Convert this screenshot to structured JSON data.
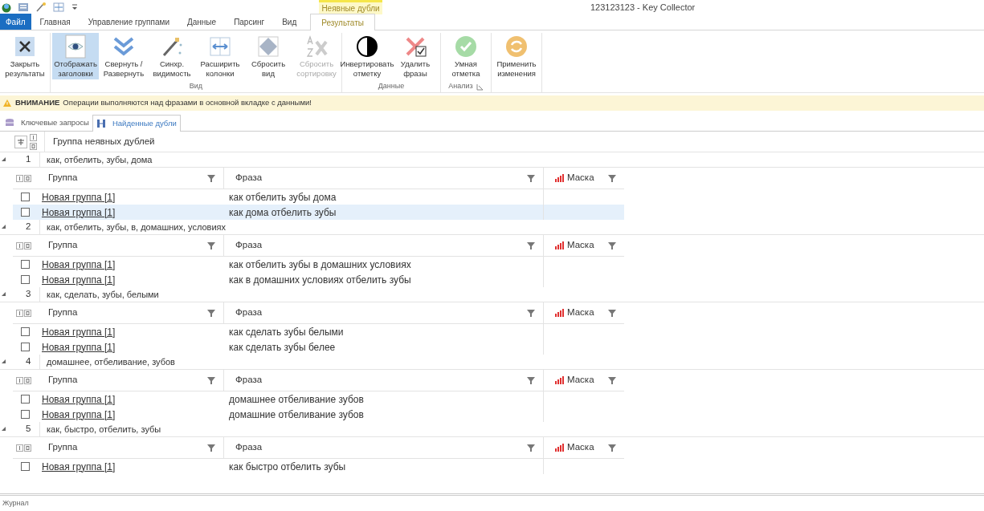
{
  "window": {
    "title": "123123123 - Key Collector"
  },
  "context_tab": {
    "label": "Неявные дубли"
  },
  "tabs": [
    {
      "label": "Файл",
      "kind": "file",
      "selected": false
    },
    {
      "label": "Главная",
      "kind": "tab",
      "selected": false
    },
    {
      "label": "Управление группами",
      "kind": "tab",
      "selected": false
    },
    {
      "label": "Данные",
      "kind": "tab",
      "selected": false
    },
    {
      "label": "Парсинг",
      "kind": "tab",
      "selected": false
    },
    {
      "label": "Вид",
      "kind": "tab",
      "selected": false
    },
    {
      "label": "Результаты",
      "kind": "tab",
      "selected": true
    }
  ],
  "ribbon_groups": [
    {
      "buttons": [
        {
          "label": "Закрыть результаты",
          "selected": false,
          "disabled": false
        }
      ]
    },
    {
      "label": "Вид",
      "buttons": [
        {
          "label": "Отображать заголовки",
          "selected": true,
          "disabled": false
        },
        {
          "label": "Свернуть / Развернуть",
          "selected": false,
          "disabled": false
        },
        {
          "label": "Синхр. видимость",
          "selected": false,
          "disabled": false
        },
        {
          "label": "Расширить колонки",
          "selected": false,
          "disabled": false
        },
        {
          "label": "Сбросить вид",
          "selected": false,
          "disabled": false
        },
        {
          "label": "Сбросить сортировку",
          "selected": false,
          "disabled": true
        }
      ]
    },
    {
      "label": "Данные",
      "buttons": [
        {
          "label": "Инвертировать отметку",
          "selected": false,
          "disabled": false
        },
        {
          "label": "Удалить фразы",
          "selected": false,
          "disabled": false
        }
      ]
    },
    {
      "label": "Анализ",
      "launcher": true,
      "buttons": [
        {
          "label": "Умная отметка",
          "selected": false,
          "disabled": false
        }
      ]
    },
    {
      "buttons": [
        {
          "label": "Применить изменения",
          "selected": false,
          "disabled": false
        }
      ]
    }
  ],
  "warning": {
    "title": "ВНИМАНИЕ",
    "text": "Операции выполняются над фразами в основной вкладке с данными!"
  },
  "doc_tabs": [
    {
      "label": "Ключевые запросы",
      "selected": false
    },
    {
      "label": "Найденные дубли",
      "selected": true
    }
  ],
  "grid": {
    "header": "Группа неявных дублей",
    "groups": [
      {
        "number": "1",
        "title": "как, отбелить, зубы, дома",
        "columns": [
          "Группа",
          "Фраза",
          "Маска"
        ],
        "rows": [
          {
            "checked": false,
            "selected": false,
            "group": "Новая группа [1]",
            "phrase": "как отбелить зубы дома"
          },
          {
            "checked": false,
            "selected": true,
            "group": "Новая группа [1]",
            "phrase": "как дома отбелить зубы"
          }
        ]
      },
      {
        "number": "2",
        "title": "как, отбелить, зубы, в, домашних, условиях",
        "columns": [
          "Группа",
          "Фраза",
          "Маска"
        ],
        "rows": [
          {
            "checked": false,
            "selected": false,
            "group": "Новая группа [1]",
            "phrase": "как отбелить зубы в домашних условиях"
          },
          {
            "checked": false,
            "selected": false,
            "group": "Новая группа [1]",
            "phrase": "как в домашних условиях отбелить зубы"
          }
        ]
      },
      {
        "number": "3",
        "title": "как, сделать, зубы, белыми",
        "columns": [
          "Группа",
          "Фраза",
          "Маска"
        ],
        "rows": [
          {
            "checked": false,
            "selected": false,
            "group": "Новая группа [1]",
            "phrase": "как сделать зубы белыми"
          },
          {
            "checked": false,
            "selected": false,
            "group": "Новая группа [1]",
            "phrase": "как сделать зубы белее"
          }
        ]
      },
      {
        "number": "4",
        "title": "домашнее, отбеливание, зубов",
        "columns": [
          "Группа",
          "Фраза",
          "Маска"
        ],
        "rows": [
          {
            "checked": false,
            "selected": false,
            "group": "Новая группа [1]",
            "phrase": "домашнее отбеливание зубов"
          },
          {
            "checked": false,
            "selected": false,
            "group": "Новая группа [1]",
            "phrase": "домашние отбеливание зубов"
          }
        ]
      },
      {
        "number": "5",
        "title": "как, быстро, отбелить, зубы",
        "columns": [
          "Группа",
          "Фраза",
          "Маска"
        ],
        "rows": [
          {
            "checked": false,
            "selected": false,
            "group": "Новая группа [1]",
            "phrase": "как быстро отбелить зубы"
          }
        ]
      }
    ]
  },
  "log_panel": {
    "title": "Журнал"
  }
}
